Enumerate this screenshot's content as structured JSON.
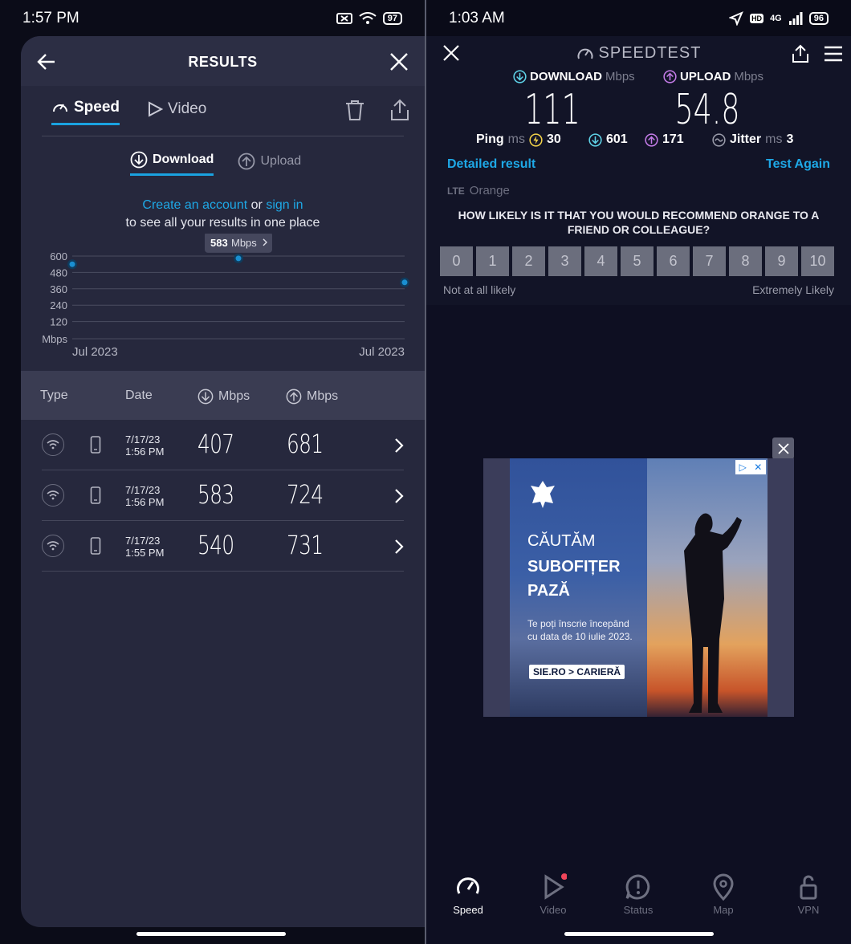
{
  "left": {
    "status": {
      "time": "1:57 PM",
      "battery": "97"
    },
    "header": {
      "title": "RESULTS"
    },
    "tabs": [
      {
        "label": "Speed"
      },
      {
        "label": "Video"
      }
    ],
    "subtabs": [
      {
        "label": "Download"
      },
      {
        "label": "Upload"
      }
    ],
    "account": {
      "create": "Create an account",
      "or": "or",
      "signin": "sign in",
      "line2": "to see all your results in one place"
    },
    "chart_data": {
      "type": "scatter",
      "x": [
        "Jul 2023",
        "",
        "Jul 2023"
      ],
      "values": [
        540,
        583,
        407
      ],
      "yticks": [
        "600",
        "480",
        "360",
        "240",
        "120"
      ],
      "yunit": "Mbps",
      "xlabels": [
        "Jul 2023",
        "Jul 2023"
      ],
      "ylim": [
        0,
        600
      ],
      "tooltip": {
        "value": "583",
        "unit": "Mbps"
      },
      "colors": {
        "point": "#1a8fd1",
        "grid": "#4a4c60"
      }
    },
    "table": {
      "headers": {
        "type": "Type",
        "date": "Date",
        "down": "Mbps",
        "up": "Mbps"
      },
      "rows": [
        {
          "date": "7/17/23",
          "time": "1:56 PM",
          "down": "407",
          "up": "681"
        },
        {
          "date": "7/17/23",
          "time": "1:56 PM",
          "down": "583",
          "up": "724"
        },
        {
          "date": "7/17/23",
          "time": "1:55 PM",
          "down": "540",
          "up": "731"
        }
      ]
    }
  },
  "right": {
    "status": {
      "time": "1:03 AM",
      "net": "4G",
      "battery": "96"
    },
    "title": "SPEEDTEST",
    "download": {
      "label": "DOWNLOAD",
      "unit": "Mbps",
      "value": "111"
    },
    "upload": {
      "label": "UPLOAD",
      "unit": "Mbps",
      "value": "54.8"
    },
    "ping": {
      "label": "Ping",
      "unit": "ms",
      "idle": "30",
      "down": "601",
      "up": "171"
    },
    "jitter": {
      "label": "Jitter",
      "unit": "ms",
      "value": "3"
    },
    "links": {
      "detailed": "Detailed result",
      "again": "Test Again"
    },
    "carrier": {
      "type": "LTE",
      "name": "Orange"
    },
    "question": "HOW LIKELY IS IT THAT YOU WOULD RECOMMEND ORANGE TO A FRIEND OR COLLEAGUE?",
    "nps": [
      "0",
      "1",
      "2",
      "3",
      "4",
      "5",
      "6",
      "7",
      "8",
      "9",
      "10"
    ],
    "nps_low": "Not at all likely",
    "nps_high": "Extremely Likely",
    "ad": {
      "line1": "CĂUTĂM",
      "line2": "SUBOFIȚER",
      "line3": "PAZĂ",
      "body1": "Te poți înscrie începând",
      "body2": "cu data de 10 iulie 2023.",
      "cta": "SIE.RO > CARIERĂ"
    },
    "nav": [
      {
        "label": "Speed"
      },
      {
        "label": "Video"
      },
      {
        "label": "Status"
      },
      {
        "label": "Map"
      },
      {
        "label": "VPN"
      }
    ]
  }
}
